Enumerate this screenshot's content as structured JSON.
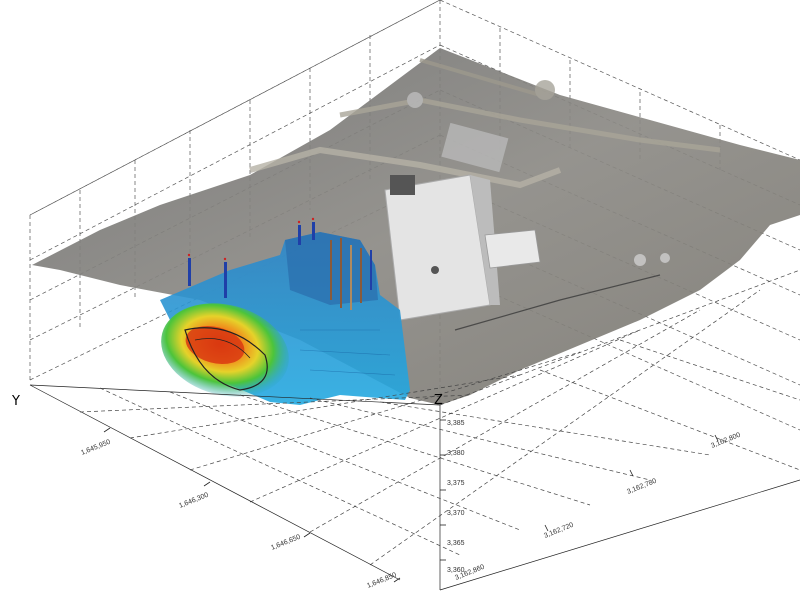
{
  "viewer": {
    "axis_titles": {
      "y": "Y",
      "z": "Z"
    },
    "y_ticks": [
      "1,645,950",
      "1,646,300",
      "1,646,650",
      "1,646,850"
    ],
    "x_ticks": [
      "3,162,860",
      "3,162,720",
      "3,162,780",
      "3,162,800"
    ],
    "z_ticks": [
      "3,385",
      "3,380",
      "3,375",
      "3,370",
      "3,365",
      "3,360"
    ]
  },
  "scene": {
    "colors": {
      "terrain": "#8d8d8d",
      "building": "#e2e2e2",
      "plume_outer": "#1e8fd0",
      "plume_mid": "#33c4a0",
      "plume_hot": "#e53a10",
      "grid_line": "#444444"
    },
    "legend_icons": [
      "3d-plume-icon",
      "satellite-terrain-icon",
      "well-marker-icon"
    ]
  }
}
